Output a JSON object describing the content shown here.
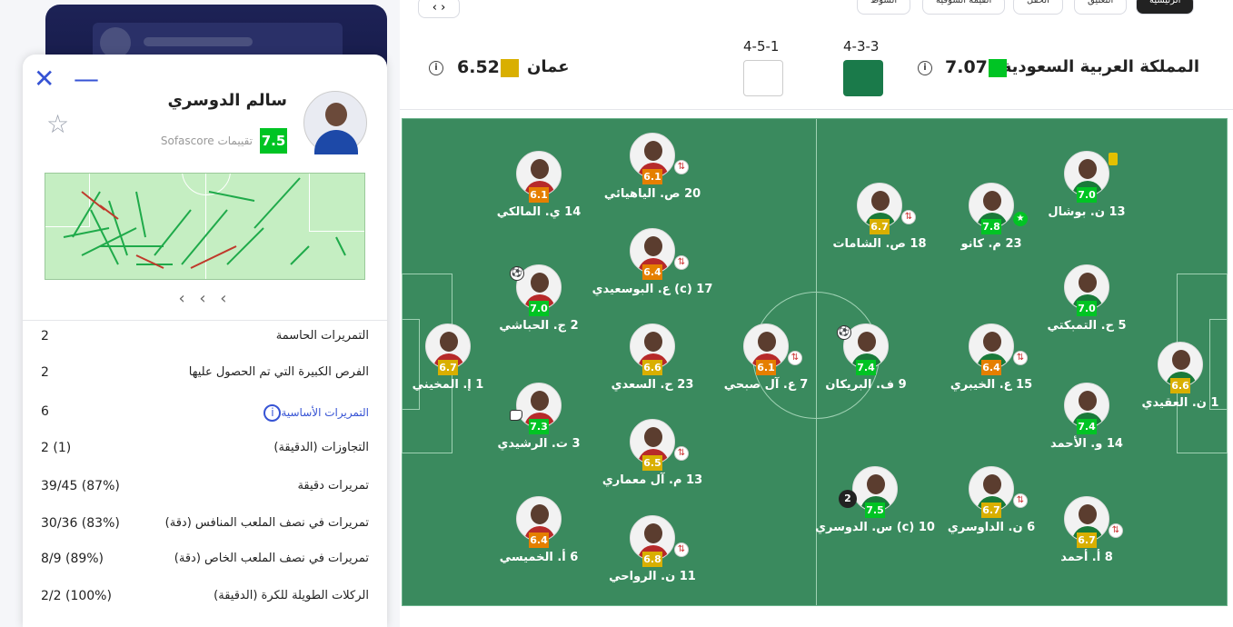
{
  "player_card": {
    "name": "سالم الدوسري",
    "rating": "7.5",
    "rating_source": "تقييمات Sofascore",
    "close_symbol": "✕",
    "minimize_symbol": "—",
    "star_symbol": "☆",
    "pager": "‹ ‹ ‹",
    "stats": [
      {
        "label": "التمريرات الحاسمة",
        "value": "2"
      },
      {
        "label": "الفرص الكبيرة التي تم الحصول عليها",
        "value": "2"
      },
      {
        "label": "التمريرات الأساسية",
        "value": "6",
        "link": true
      },
      {
        "label": "التجاوزات (الدقيقة)",
        "value": "2 (1)"
      },
      {
        "label": "تمريرات دقيقة",
        "value": "39/45 (87%)"
      },
      {
        "label": "تمريرات في نصف الملعب المنافس (دقة)",
        "value": "30/36 (83%)"
      },
      {
        "label": "تمريرات في نصف الملعب الخاص (دقة)",
        "value": "8/9 (89%)"
      },
      {
        "label": "الركلات الطويلة للكرة (الدقيقة)",
        "value": "2/2 (100%)"
      }
    ]
  },
  "header": {
    "team_home": "المملكة العربية السعودية",
    "rating_home": "7.07",
    "formation_home": "4-3-3",
    "team_away": "عمان",
    "rating_away": "6.52",
    "formation_away": "4-5-1",
    "info_icon": "i",
    "nav_arrows": "‹ ›",
    "tabs": [
      "الرئيسية",
      "التعليق",
      "الحقل",
      "القيمة السوقية",
      "الشوط"
    ]
  },
  "colors": {
    "green": "#00c424",
    "orange": "#e57f00",
    "yellow": "#d9af00",
    "pitch": "#3a8a5e"
  },
  "home_players": [
    {
      "name": "13 ن. بوشال",
      "rating": "7.0"
    },
    {
      "name": "23 م. كانو",
      "rating": "7.8"
    },
    {
      "name": "18 ص. الشامات",
      "rating": "6.7"
    },
    {
      "name": "5 ح. التمبكتي",
      "rating": "7.0"
    },
    {
      "name": "1 ن. العقيدي",
      "rating": "6.6"
    },
    {
      "name": "15 ع. الخيبري",
      "rating": "6.4"
    },
    {
      "name": "9 ف. البريكان",
      "rating": "7.4"
    },
    {
      "name": "14 و. الأحمد",
      "rating": "7.4"
    },
    {
      "name": "8 أ. أحمد",
      "rating": "6.7"
    },
    {
      "name": "6 ن. الداوسري",
      "rating": "6.7"
    },
    {
      "name": "10 (c) س. الدوسري",
      "rating": "7.5"
    }
  ],
  "away_players": [
    {
      "name": "20 ص. الياهيائي",
      "rating": "6.1"
    },
    {
      "name": "14 ي. المالكي",
      "rating": "6.1"
    },
    {
      "name": "17 (c) ع. البوسعيدي",
      "rating": "6.4"
    },
    {
      "name": "2 ج. الحباشي",
      "rating": "7.0"
    },
    {
      "name": "1 إ. المخيني",
      "rating": "6.7"
    },
    {
      "name": "23 ح. السعدي",
      "rating": "6.6"
    },
    {
      "name": "7 ع. آل صبحي",
      "rating": "6.1"
    },
    {
      "name": "3 ت. الرشيدي",
      "rating": "7.3"
    },
    {
      "name": "13 م. آل معماري",
      "rating": "6.5"
    },
    {
      "name": "6 أ. الخميسي",
      "rating": "6.4"
    },
    {
      "name": "11 ن. الرواحي",
      "rating": "6.8"
    }
  ]
}
